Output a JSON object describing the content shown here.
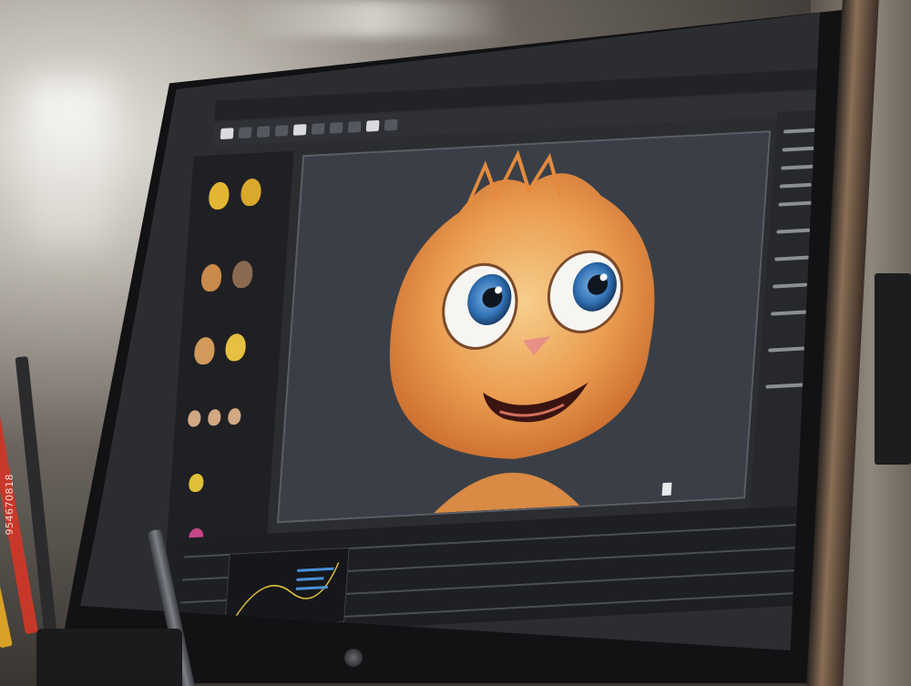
{
  "image": {
    "kind": "photograph",
    "subject": "monitor-with-3d-character-software",
    "watermark_text": "954670818"
  },
  "software": {
    "menu_items": [
      "",
      "",
      "",
      "",
      "",
      ""
    ],
    "viewport_subject": "orange-furry-cartoon-creature"
  },
  "colors": {
    "fur": "#e8914a",
    "fur_light": "#f2c07a",
    "eye_iris": "#3d7fc4",
    "ui_dark": "#2b2d31",
    "pencil_red": "#c8382a",
    "pencil_yellow": "#e0a52a"
  }
}
